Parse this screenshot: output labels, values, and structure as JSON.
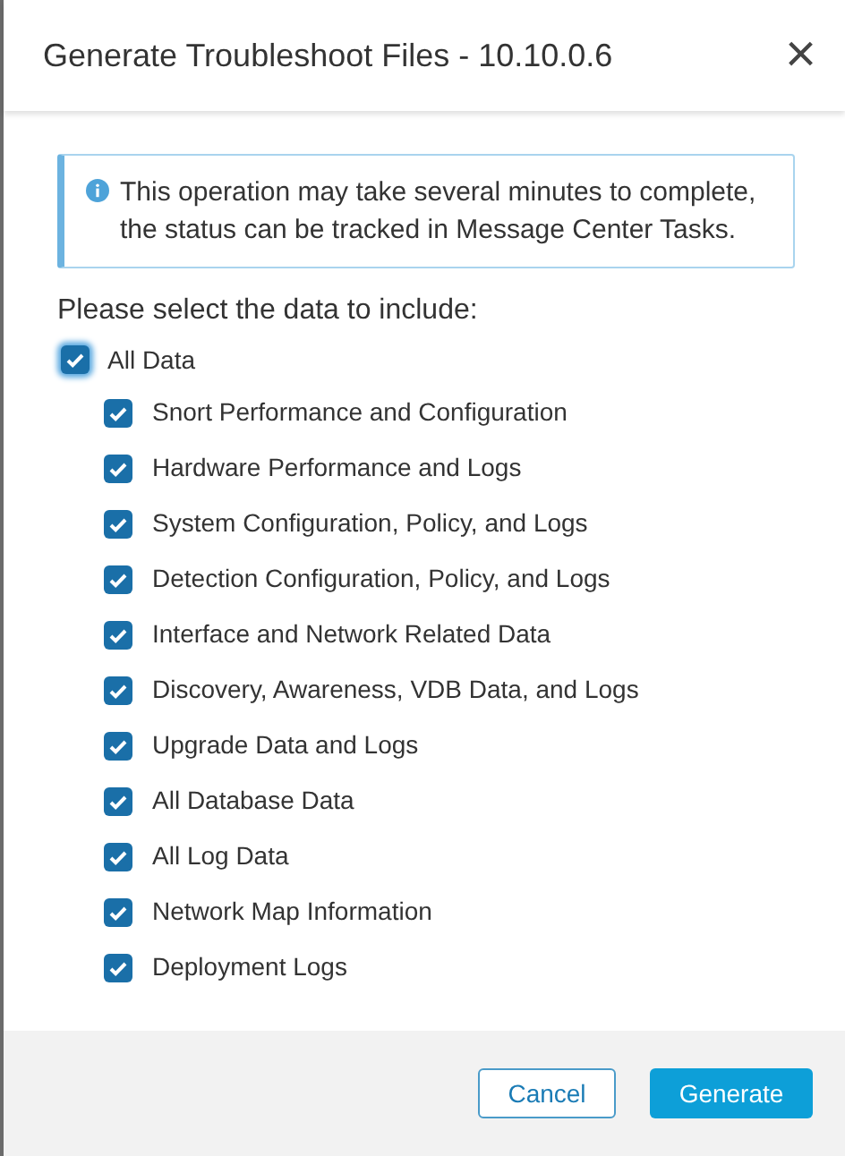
{
  "dialog": {
    "title": "Generate Troubleshoot Files - 10.10.0.6",
    "close": "×"
  },
  "notice": "This operation may take several minutes to complete, the status can be tracked in Message Center Tasks.",
  "prompt": "Please select the data to include:",
  "all": {
    "label": "All Data",
    "checked": true
  },
  "options": [
    {
      "label": "Snort Performance and Configuration",
      "checked": true
    },
    {
      "label": "Hardware Performance and Logs",
      "checked": true
    },
    {
      "label": "System Configuration, Policy, and Logs",
      "checked": true
    },
    {
      "label": "Detection Configuration, Policy, and Logs",
      "checked": true
    },
    {
      "label": "Interface and Network Related Data",
      "checked": true
    },
    {
      "label": "Discovery, Awareness, VDB Data, and Logs",
      "checked": true
    },
    {
      "label": "Upgrade Data and Logs",
      "checked": true
    },
    {
      "label": "All Database Data",
      "checked": true
    },
    {
      "label": "All Log Data",
      "checked": true
    },
    {
      "label": "Network Map Information",
      "checked": true
    },
    {
      "label": "Deployment Logs",
      "checked": true
    }
  ],
  "buttons": {
    "cancel": "Cancel",
    "generate": "Generate"
  }
}
